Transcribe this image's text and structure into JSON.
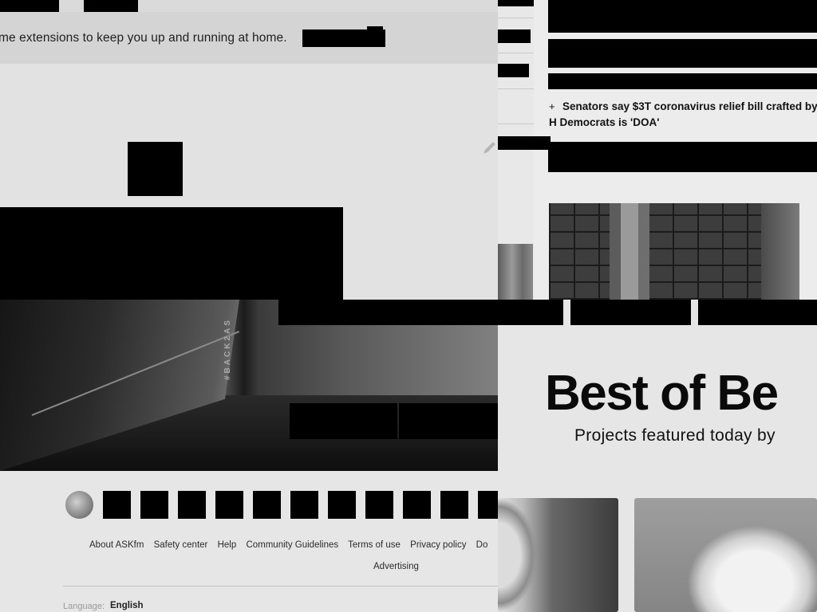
{
  "chrome_store": {
    "banner_text": "me extensions to keep you up and running at home."
  },
  "hero": {
    "tag": "#BACK2AS"
  },
  "askfm_footer": {
    "links": [
      "About ASKfm",
      "Safety center",
      "Help",
      "Community Guidelines",
      "Terms of use",
      "Privacy policy",
      "Do"
    ],
    "advertising": "Advertising",
    "language_label": "Language:",
    "language_value": "English"
  },
  "news": {
    "bullet": "+",
    "headline": "Senators say $3T coronavirus relief bill crafted by H Democrats is 'DOA'"
  },
  "behance": {
    "title": "Best of Be",
    "subtitle": "Projects featured today by"
  }
}
